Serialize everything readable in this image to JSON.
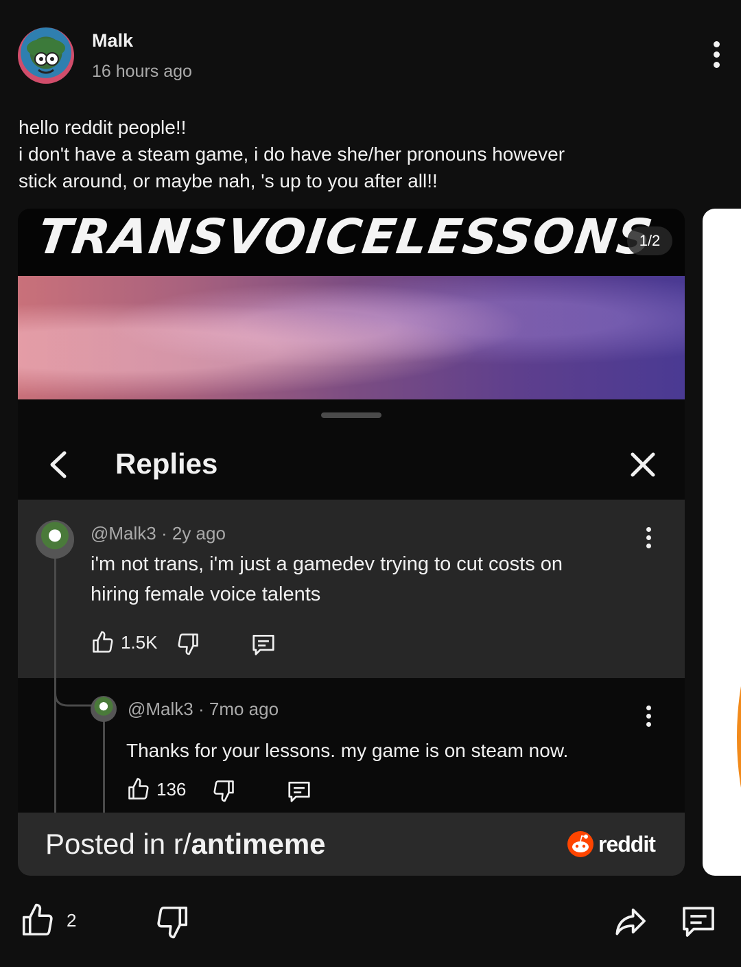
{
  "post": {
    "author": "Malk",
    "time": "16 hours ago",
    "text_lines": [
      "hello reddit people!!",
      "i don't have a steam game, i do have she/her pronouns however",
      "stick around, or maybe nah, 's up to you after all!!"
    ],
    "like_count": "2"
  },
  "media": {
    "banner_title": "TRANSVOICELESSONS",
    "counter": "1/2",
    "replies_title": "Replies",
    "comment": {
      "meta": "@Malk3 · 2y ago",
      "text_lines": [
        "i'm not trans, i'm just a gamedev trying to cut costs on",
        "hiring female voice talents"
      ],
      "likes": "1.5K"
    },
    "reply": {
      "meta": "@Malk3 · 7mo ago",
      "text": "Thanks for your lessons. my game is on steam now.",
      "likes": "136"
    },
    "posted_in_prefix": "Posted in r/",
    "posted_in_sub": "antimeme",
    "brand": "reddit"
  },
  "colors": {
    "background": "#0f0f0f",
    "card": "#272727",
    "reddit_orange": "#ff4500"
  },
  "icons": [
    "more-vert-icon",
    "back-chevron-icon",
    "close-icon",
    "thumb-up-icon",
    "thumb-down-icon",
    "comment-icon",
    "share-icon",
    "reddit-logo-icon"
  ]
}
